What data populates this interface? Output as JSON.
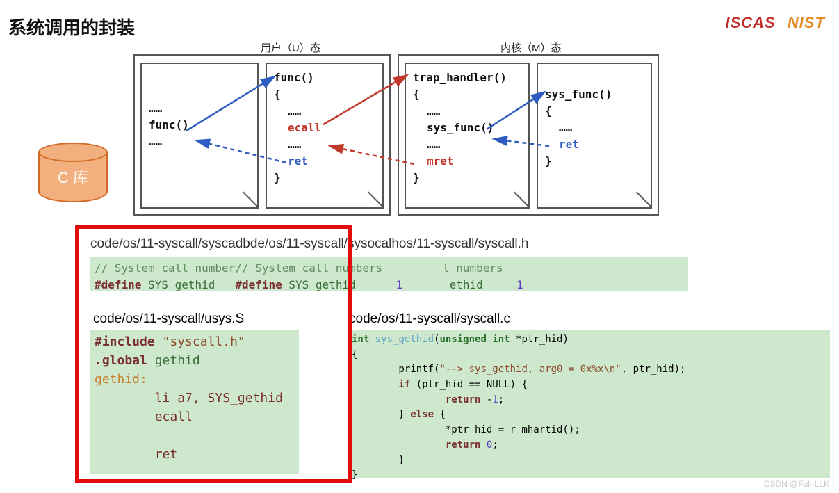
{
  "title": "系统调用的封装",
  "logos": {
    "iscas": "ISCAS",
    "nist": "NIST"
  },
  "modes": {
    "user": "用户（U）态",
    "kernel": "内核（M）态"
  },
  "clib": "C 库",
  "pages": {
    "p1": {
      "l1": "……",
      "l2": "func()",
      "l3": "……"
    },
    "p2": {
      "l1": "func()",
      "l2": "{",
      "l3": "……",
      "l4": "ecall",
      "l5": "……",
      "l6": "ret",
      "l7": "}"
    },
    "p3": {
      "l1": "trap_handler()",
      "l2": "{",
      "l3": "……",
      "l4": "sys_func()",
      "l5": "……",
      "l6": "mret",
      "l7": "}"
    },
    "p4": {
      "l1": "sys_func()",
      "l2": "{",
      "l3": "……",
      "l4": "ret",
      "l5": "}"
    }
  },
  "headerPathsOverlap": "code/os/11-syscall/syscadbde/os/11-syscall/sysocalhos/11-syscall/syscall.h",
  "headerCode": {
    "line1_a": "// System call number",
    "line1_b": "// System call numbers",
    "line1_c": "l numbers",
    "line2_def": "#define",
    "line2_sym": "SYS_gethid",
    "line2_def2": "#define",
    "line2_sym2": "SYS_gethid",
    "line2_val": "1",
    "line2_sym3": "ethid",
    "line2_val3": "1"
  },
  "paths": {
    "usys": "code/os/11-syscall/usys.S",
    "syscallc": "code/os/11-syscall/syscall.c"
  },
  "usys": {
    "l1a": "#include",
    "l1b": "\"syscall.h\"",
    "l2a": ".global",
    "l2b": "gethid",
    "l3": "gethid:",
    "l4": "        li a7, SYS_gethid",
    "l5": "        ecall",
    "l6": "",
    "l7": "        ret"
  },
  "syscallc": {
    "l1a": "int",
    "l1b": "sys_gethid",
    "l1c": "(",
    "l1d": "unsigned int",
    "l1e": " *ptr_hid)",
    "l2": "{",
    "l3a": "        printf(",
    "l3b": "\"--> sys_gethid, arg0 = 0x%x\\n\"",
    "l3c": ", ptr_hid);",
    "l4a": "        if",
    "l4b": " (ptr_hid == NULL) {",
    "l5a": "                return",
    "l5b": " -",
    "l5c": "1",
    "l5d": ";",
    "l6a": "        } ",
    "l6b": "else",
    "l6c": " {",
    "l7": "                *ptr_hid = r_mhartid();",
    "l8a": "                return ",
    "l8b": "0",
    "l8c": ";",
    "l9": "        }",
    "l10": "}"
  },
  "watermark": "CSDN @Full-LLK"
}
